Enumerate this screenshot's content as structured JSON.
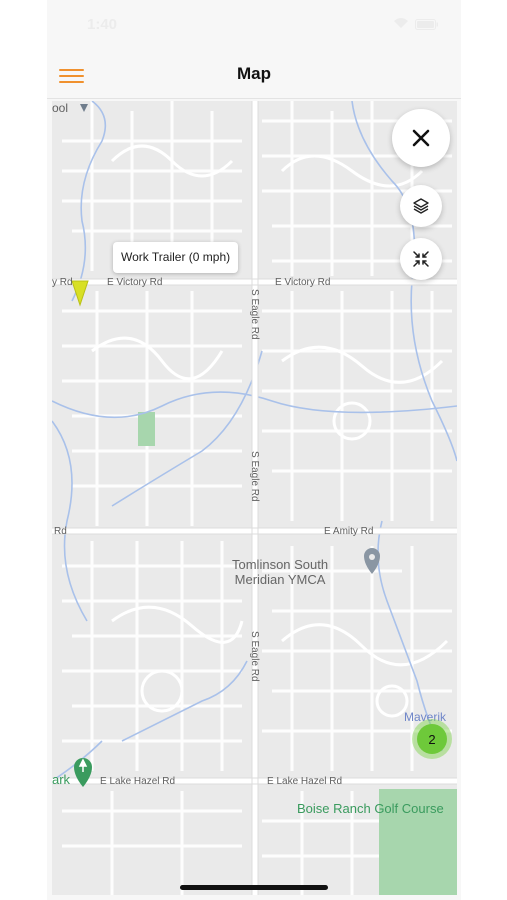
{
  "status_bar": {
    "time": "1:40"
  },
  "header": {
    "title": "Map",
    "menu_icon": "hamburger-menu-icon"
  },
  "map": {
    "roads": {
      "victory_west": "E Victory Rd",
      "victory_east": "E Victory Rd",
      "victory_edge": "y Rd",
      "amity_east": "E Amity Rd",
      "amity_edge": "Rd",
      "lake_hazel_west": "E Lake Hazel Rd",
      "lake_hazel_east": "E Lake Hazel Rd",
      "eagle_1": "S Eagle Rd",
      "eagle_2": "S Eagle Rd",
      "eagle_3": "S Eagle Rd"
    },
    "poi": {
      "ymca": "Tomlinson South\nMeridian YMCA",
      "golf": "Boise Ranch Golf Course",
      "maverik": "Maverik",
      "park_edge": "ark",
      "school_edge": "ool"
    },
    "vehicle_tooltip": "Work Trailer (0 mph)",
    "cluster_count": "2"
  },
  "controls": {
    "close_icon": "close-icon",
    "layers_icon": "layers-icon",
    "collapse_icon": "collapse-icon"
  },
  "colors": {
    "accent": "#f0912e",
    "cluster": "#6ec93a",
    "vehicle_marker": "#d8e025"
  }
}
